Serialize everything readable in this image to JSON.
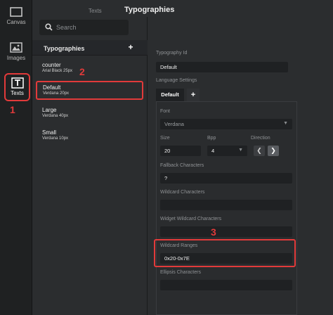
{
  "rail": {
    "canvas_label": "Canvas",
    "images_label": "Images",
    "texts_label": "Texts"
  },
  "annotations": {
    "one": "1",
    "two": "2",
    "three": "3"
  },
  "header": {
    "crumb": "Texts",
    "title": "Typographies"
  },
  "search": {
    "placeholder": "Search"
  },
  "list": {
    "title": "Typographies",
    "add": "+",
    "items": [
      {
        "name": "counter",
        "meta": "Arial Black  25px"
      },
      {
        "name": "Default",
        "meta": "Verdana  20px"
      },
      {
        "name": "Large",
        "meta": "Verdana  40px"
      },
      {
        "name": "Small",
        "meta": "Verdana  10px"
      }
    ]
  },
  "props": {
    "typography_id_label": "Typography Id",
    "typography_id_value": "Default",
    "language_settings_label": "Language Settings",
    "tab_default": "Default",
    "tab_add": "+",
    "font_label": "Font",
    "font_value": "Verdana",
    "size_label": "Size",
    "size_value": "20",
    "bpp_label": "Bpp",
    "bpp_value": "4",
    "direction_label": "Direction",
    "direction_left": "❮",
    "direction_right": "❯",
    "fallback_label": "Fallback Characters",
    "fallback_value": "?",
    "wildcard_label": "Wildcard Characters",
    "wildcard_value": "",
    "widget_wildcard_label": "Widget Wildcard Characters",
    "widget_wildcard_value": "",
    "wildcard_ranges_label": "Wildcard Ranges",
    "wildcard_ranges_value": "0x20-0x7E",
    "ellipsis_label": "Ellipsis Characters",
    "ellipsis_value": ""
  },
  "colors": {
    "accent_red": "#e23a3a",
    "panel": "#2b2d2f",
    "field": "#1f2123"
  }
}
